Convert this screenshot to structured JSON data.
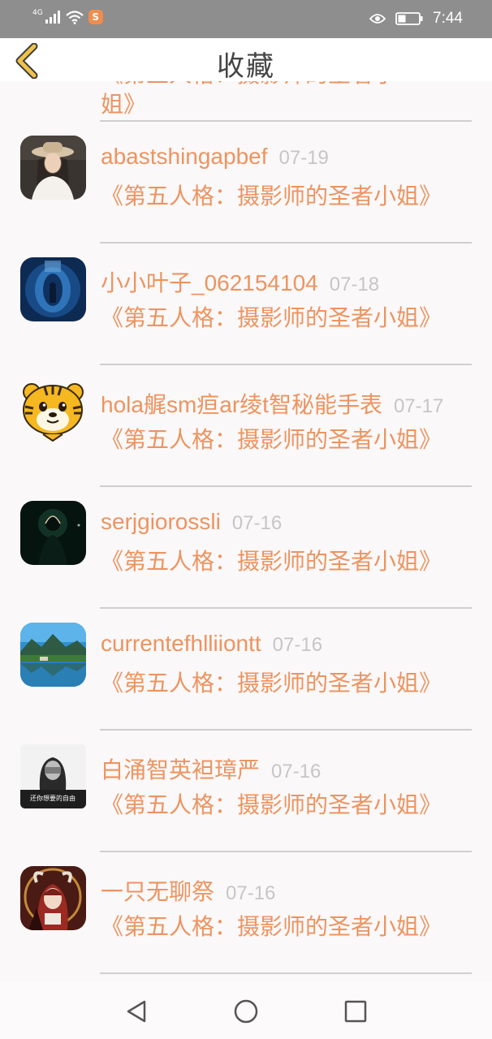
{
  "status_bar": {
    "network": "4G",
    "time": "7:44",
    "app_badge": "S"
  },
  "header": {
    "title": "收藏"
  },
  "partial_item": {
    "work_line_1": "《第五人格：摄影师的圣者小",
    "work_line_2": "姐》"
  },
  "items": [
    {
      "name": "abastshingapbef",
      "date": "07-19",
      "work": "《第五人格：摄影师的圣者小姐》",
      "avatar": "woman-hat-avatar"
    },
    {
      "name": "小小叶子_062154104",
      "date": "07-18",
      "work": "《第五人格：摄影师的圣者小姐》",
      "avatar": "blue-photo-avatar"
    },
    {
      "name": "hola艉sm疸ar绫t智秘能手表",
      "date": "07-17",
      "work": "《第五人格：摄影师的圣者小姐》",
      "avatar": "tiger-avatar"
    },
    {
      "name": "serjgiorossli",
      "date": "07-16",
      "work": "《第五人格：摄影师的圣者小姐》",
      "avatar": "dark-silhouette-avatar"
    },
    {
      "name": "currentefhlliiontt",
      "date": "07-16",
      "work": "《第五人格：摄影师的圣者小姐》",
      "avatar": "lake-landscape-avatar"
    },
    {
      "name": "白涌智英袒璋严",
      "date": "07-16",
      "work": "《第五人格：摄影师的圣者小姐》",
      "avatar": "bw-portrait-avatar",
      "avatar_caption": "还你想要的自由"
    },
    {
      "name": "一只无聊祭",
      "date": "07-16",
      "work": "《第五人格：摄影师的圣者小姐》",
      "avatar": "anime-character-avatar"
    }
  ],
  "colors": {
    "accent": "#ec9460",
    "date_gray": "#c6c6c6",
    "divider": "#cfcfcf",
    "status_bar": "#8e8e8e"
  }
}
